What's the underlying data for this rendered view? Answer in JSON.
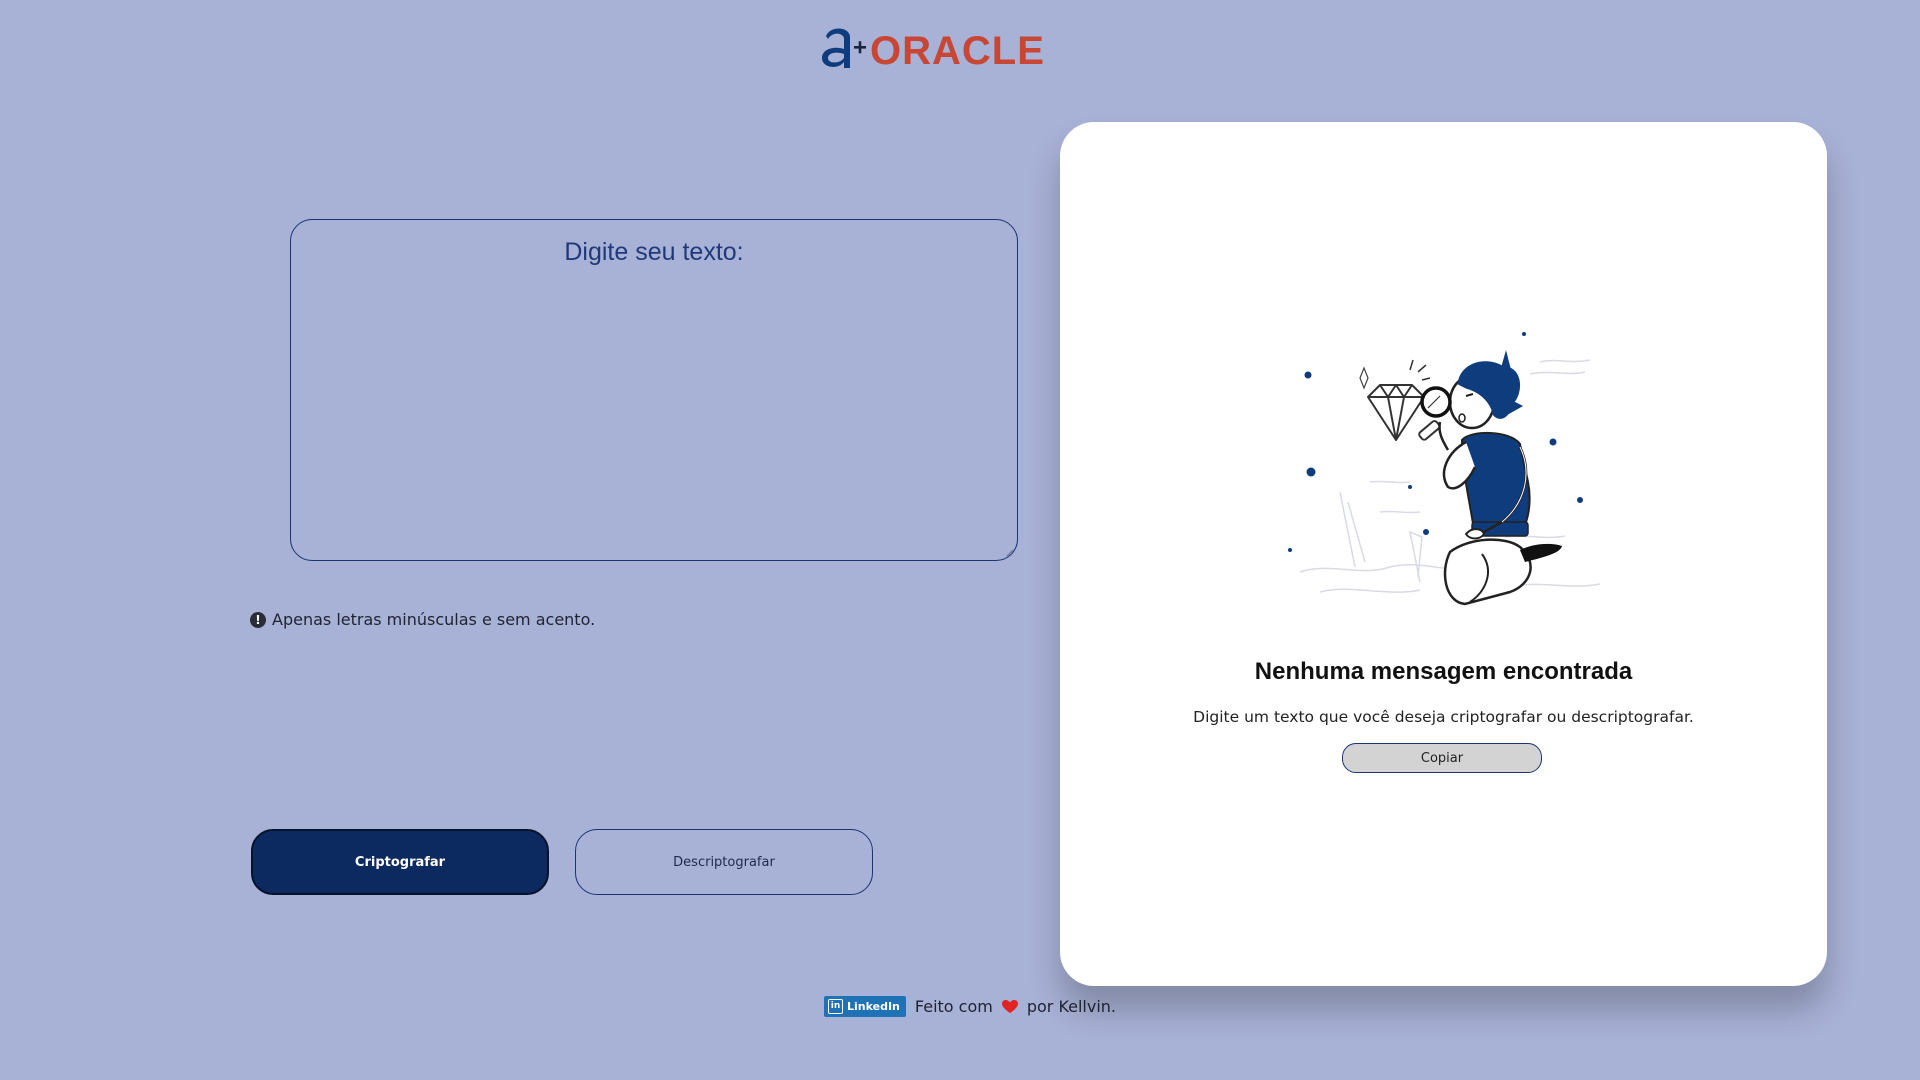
{
  "logo": {
    "alura_mark": "a+",
    "brand_text": "ORACLE",
    "colors": {
      "alura_blue": "#0f3c7d",
      "oracle_red": "#c74634"
    }
  },
  "input": {
    "placeholder": "Digite seu texto:",
    "value": ""
  },
  "hint": {
    "icon": "exclamation-circle-icon",
    "text": "Apenas letras minúsculas e sem acento."
  },
  "buttons": {
    "encrypt_label": "Criptografar",
    "decrypt_label": "Descriptografar"
  },
  "output_panel": {
    "illustration": "person-with-magnifying-glass-and-diamond",
    "title": "Nenhuma mensagem encontrada",
    "subtitle": "Digite um texto que você deseja criptografar ou descriptografar.",
    "copy_label": "Copiar"
  },
  "footer": {
    "linkedin_label": "LinkedIn",
    "text_before": "Feito com",
    "heart_icon": "heart-icon",
    "text_after": "por Kellvin."
  },
  "colors": {
    "background": "#a8b1d6",
    "primary": "#0d2a60",
    "panel": "#ffffff",
    "heart": "#e02424"
  }
}
